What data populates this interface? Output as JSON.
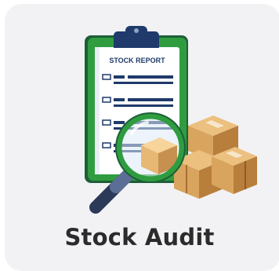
{
  "tile": {
    "label": "Stock Audit",
    "icon_name": "stock-report-audit-icon"
  },
  "report": {
    "heading": "STOCK REPORT"
  },
  "colors": {
    "tile_background": "#f2f2f5",
    "label_text": "#2b2b2b",
    "clipboard_green": "#2f9d3f",
    "clipboard_dark": "#1d5f38",
    "paper": "#ffffff",
    "list_navy": "#1f3a6b",
    "box_tan": "#d9a45e",
    "box_shadow": "#b87e3c",
    "magnifier_handle": "#2c3a5a"
  }
}
